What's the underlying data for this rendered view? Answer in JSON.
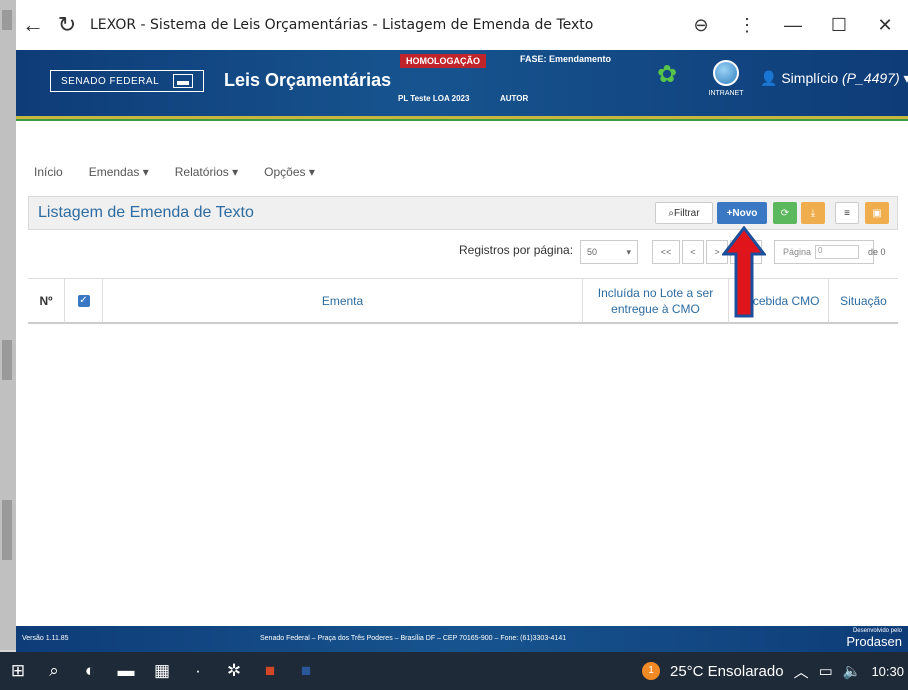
{
  "browser": {
    "title": "LEXOR - Sistema de Leis Orçamentárias - Listagem de Emenda de Texto"
  },
  "header": {
    "org": "SENADO FEDERAL",
    "app_title": "Leis Orçamentárias",
    "env_badge": "HOMOLOGAÇÃO",
    "fase": "FASE: Emendamento",
    "pl": "PL Teste LOA 2023",
    "autor": "AUTOR",
    "intranet": "INTRANET",
    "user_name": "Simplício",
    "user_id": "(P_4497)"
  },
  "menu": {
    "items": [
      "Início",
      "Emendas ▾",
      "Relatórios ▾",
      "Opções ▾"
    ]
  },
  "panel": {
    "title": "Listagem de Emenda de Texto",
    "filter_label": "Filtrar",
    "novo_label": "+Novo"
  },
  "pagination": {
    "records_label": "Registros por página:",
    "per_page": "50",
    "first": "<<",
    "prev": "<",
    "next": ">",
    "last": ">>",
    "page_label": "Página",
    "page_value": "0",
    "of_label": "de 0"
  },
  "table": {
    "columns": [
      "Nº",
      "",
      "Ementa",
      "Incluída no Lote a ser entregue à CMO",
      "Recebida CMO",
      "Situação"
    ]
  },
  "footer": {
    "version": "Versão 1.11.85",
    "address": "Senado Federal – Praça dos Três Poderes – Brasília DF – CEP 70165-900 – Fone: (61)3303-4141",
    "dev_small": "Desenvolvido pelo",
    "dev_name": "Prodasen"
  },
  "taskbar": {
    "weather": "25°C Ensolarado",
    "time": "10:30",
    "notification_count": "1"
  },
  "colors": {
    "header_blue": "#17548f",
    "accent_blue": "#2d6ca2",
    "btn_blue": "#3a78c4",
    "arrow_red": "#e0141b"
  }
}
